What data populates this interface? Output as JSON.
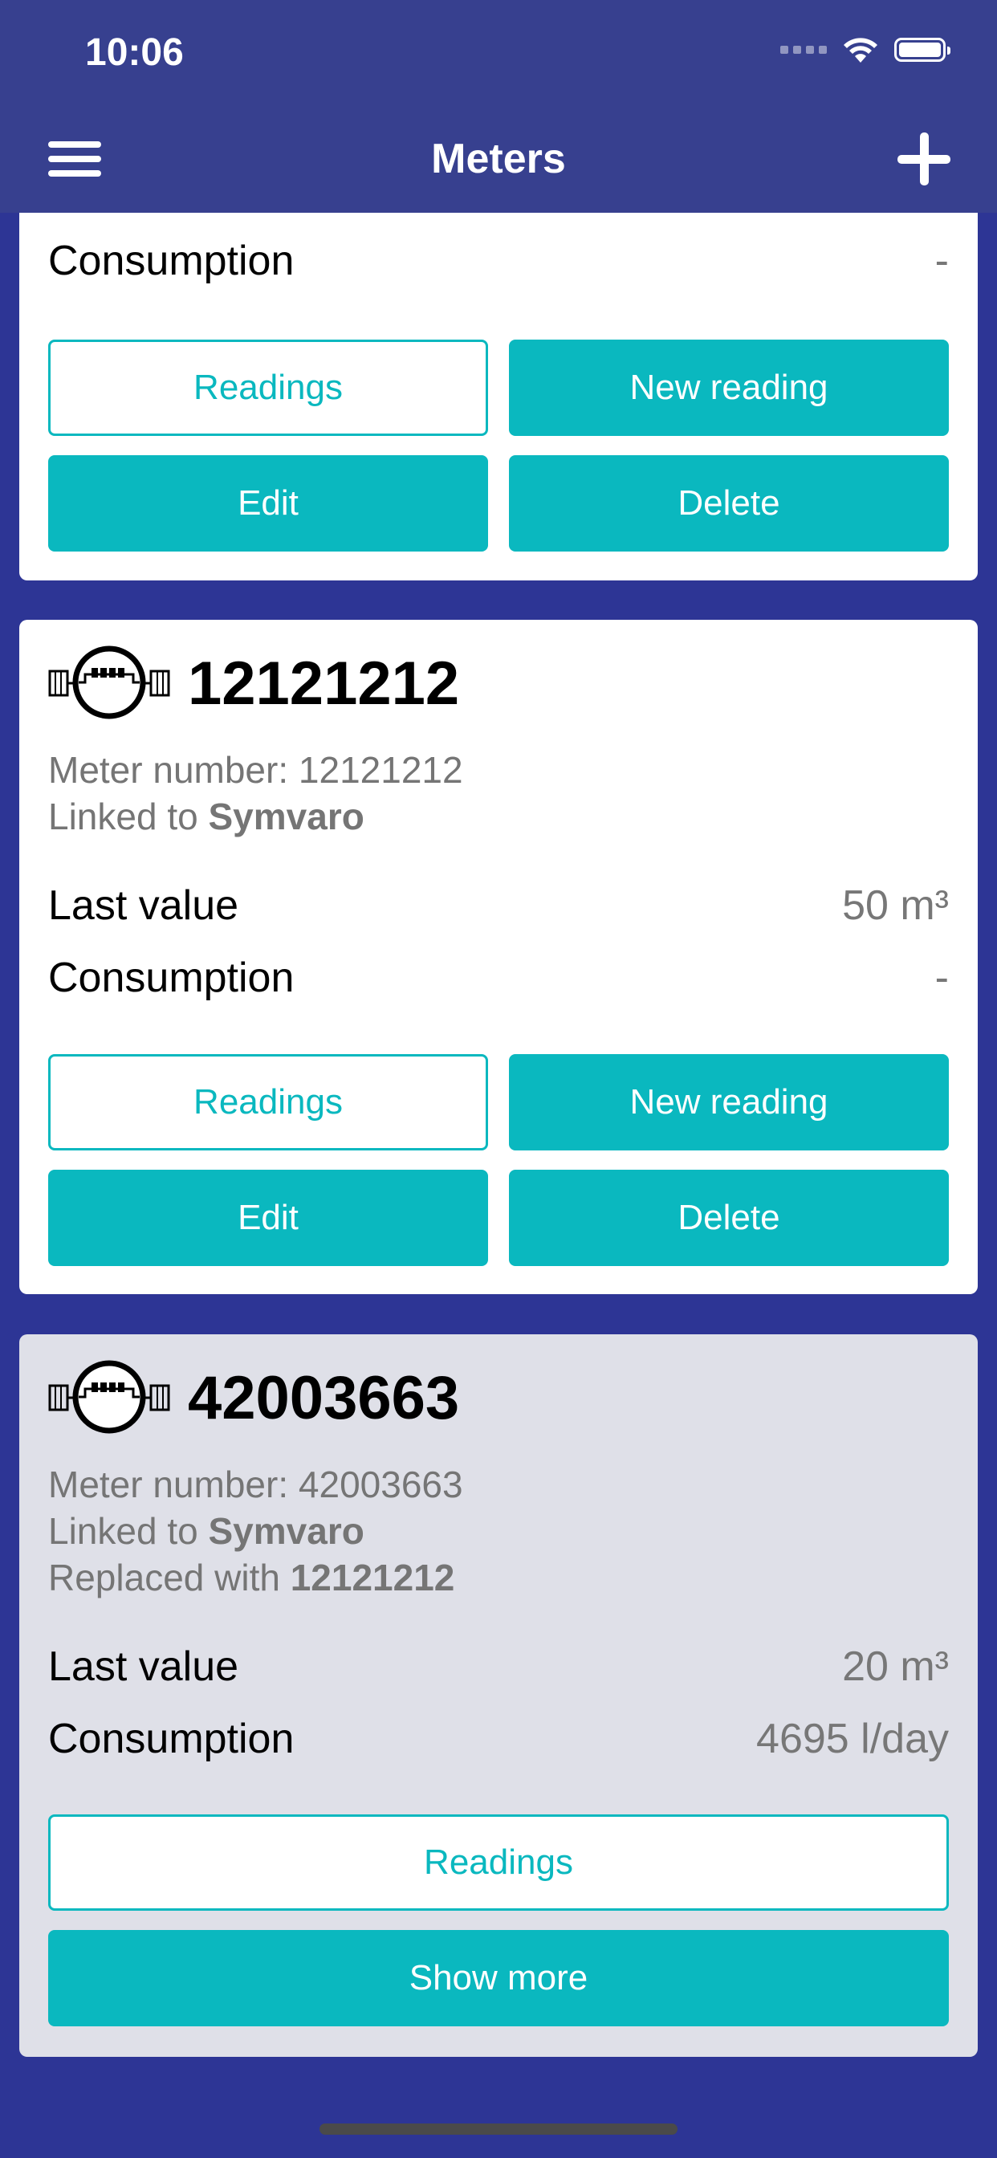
{
  "status_bar": {
    "time": "10:06"
  },
  "nav": {
    "title": "Meters",
    "menu_icon": "hamburger-icon",
    "add_icon": "plus-icon"
  },
  "cards": [
    {
      "consumption_label": "Consumption",
      "consumption_value": "-",
      "buttons": {
        "readings": "Readings",
        "new_reading": "New reading",
        "edit": "Edit",
        "delete": "Delete"
      }
    },
    {
      "title": "12121212",
      "icon": "water-meter-icon",
      "meter_number_label": "Meter number:",
      "meter_number": "12121212",
      "linked_label": "Linked to",
      "linked_to": "Symvaro",
      "last_value_label": "Last value",
      "last_value": "50 m³",
      "consumption_label": "Consumption",
      "consumption_value": "-",
      "buttons": {
        "readings": "Readings",
        "new_reading": "New reading",
        "edit": "Edit",
        "delete": "Delete"
      }
    },
    {
      "title": "42003663",
      "icon": "water-meter-icon",
      "meter_number_label": "Meter number:",
      "meter_number": "42003663",
      "linked_label": "Linked to",
      "linked_to": "Symvaro",
      "replaced_label": "Replaced with",
      "replaced_with": "12121212",
      "last_value_label": "Last value",
      "last_value": "20 m³",
      "consumption_label": "Consumption",
      "consumption_value": "4695 l/day",
      "buttons": {
        "readings": "Readings",
        "show_more": "Show more"
      }
    }
  ],
  "colors": {
    "header": "#37408f",
    "background": "#2d3595",
    "accent": "#0ab8bf",
    "inactive_card": "#dfe0e8"
  }
}
